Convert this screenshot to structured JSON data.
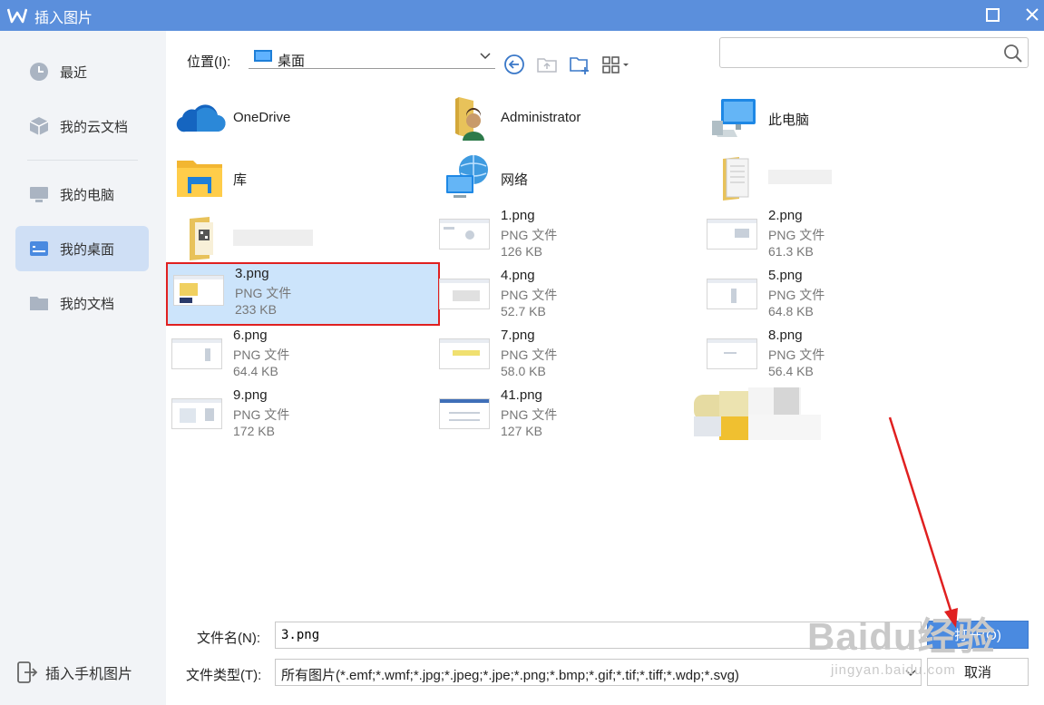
{
  "window": {
    "title": "插入图片"
  },
  "sidebar": {
    "items": [
      {
        "label": "最近",
        "icon": "clock-icon"
      },
      {
        "label": "我的云文档",
        "icon": "cube-icon"
      },
      {
        "label": "我的电脑",
        "icon": "monitor-icon"
      },
      {
        "label": "我的桌面",
        "icon": "desktop-icon",
        "active": true
      },
      {
        "label": "我的文档",
        "icon": "folder-icon"
      }
    ],
    "bottom_label": "插入手机图片"
  },
  "location": {
    "label": "位置(I):",
    "value": "桌面"
  },
  "search": {
    "placeholder": ""
  },
  "items": [
    {
      "name": "OneDrive",
      "kind": "onedrive"
    },
    {
      "name": "Administrator",
      "kind": "user-folder"
    },
    {
      "name": "此电脑",
      "kind": "computer"
    },
    {
      "name": "库",
      "kind": "library"
    },
    {
      "name": "网络",
      "kind": "network"
    },
    {
      "name": "",
      "kind": "folder-doc"
    },
    {
      "name": "",
      "kind": "folder-qr"
    },
    {
      "name": "1.png",
      "type": "PNG 文件",
      "size": "126 KB"
    },
    {
      "name": "2.png",
      "type": "PNG 文件",
      "size": "61.3 KB"
    },
    {
      "name": "3.png",
      "type": "PNG 文件",
      "size": "233 KB",
      "selected": true
    },
    {
      "name": "4.png",
      "type": "PNG 文件",
      "size": "52.7 KB"
    },
    {
      "name": "5.png",
      "type": "PNG 文件",
      "size": "64.8 KB"
    },
    {
      "name": "6.png",
      "type": "PNG 文件",
      "size": "64.4 KB"
    },
    {
      "name": "7.png",
      "type": "PNG 文件",
      "size": "58.0 KB"
    },
    {
      "name": "8.png",
      "type": "PNG 文件",
      "size": "56.4 KB"
    },
    {
      "name": "9.png",
      "type": "PNG 文件",
      "size": "172 KB"
    },
    {
      "name": "41.png",
      "type": "PNG 文件",
      "size": "127 KB"
    }
  ],
  "bottom": {
    "filename_label": "文件名(N):",
    "filename_value": "3.png",
    "filetype_label": "文件类型(T):",
    "filetype_value": "所有图片(*.emf;*.wmf;*.jpg;*.jpeg;*.jpe;*.png;*.bmp;*.gif;*.tif;*.tiff;*.wdp;*.svg)",
    "open_label": "打开(O)",
    "cancel_label": "取消"
  },
  "watermark": {
    "text": "Baidu经验",
    "sub": "jingyan.baidu.com"
  },
  "colors": {
    "titlebar": "#5b8fdc",
    "selection": "#cce4fb",
    "highlight_box": "#e02020",
    "accent": "#4a8ae0"
  }
}
